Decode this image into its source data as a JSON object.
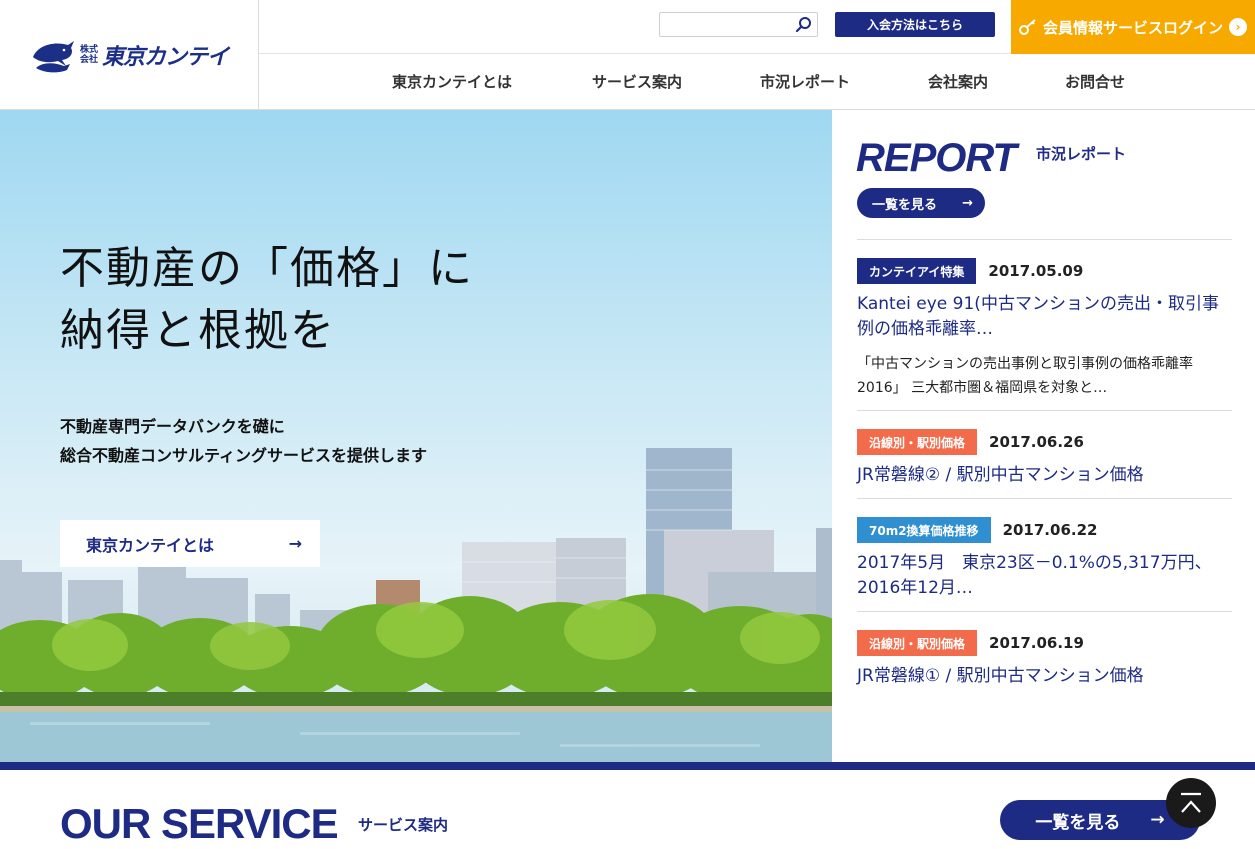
{
  "header": {
    "logo": {
      "sub_line1": "株式",
      "sub_line2": "会社",
      "name": "東京カンテイ"
    },
    "search": {
      "placeholder": "",
      "icon": "search-icon"
    },
    "join_label": "入会方法はこちら",
    "login_label": "会員情報サービスログイン",
    "login_icon": "key-icon",
    "nav": [
      {
        "label": "東京カンテイとは"
      },
      {
        "label": "サービス案内"
      },
      {
        "label": "市況レポート"
      },
      {
        "label": "会社案内"
      },
      {
        "label": "お問合せ"
      }
    ]
  },
  "hero": {
    "title_line1": "不動産の「価格」に",
    "title_line2": "納得と根拠を",
    "lead_line1": "不動産専門データバンクを礎に",
    "lead_line2": "総合不動産コンサルティングサービスを提供します",
    "button_label": "東京カンテイとは",
    "arrow": "→"
  },
  "report": {
    "heading_en": "REPORT",
    "heading_ja": "市況レポート",
    "all_label": "一覧を見る",
    "arrow": "→",
    "items": [
      {
        "tag": "カンテイアイ特集",
        "tag_color": "#1e2b84",
        "date": "2017.05.09",
        "title": "Kantei eye 91(中古マンションの売出・取引事例の価格乖離率…",
        "desc": "「中古マンションの売出事例と取引事例の価格乖離率 2016」 三大都市圏＆福岡県を対象と…"
      },
      {
        "tag": "沿線別・駅別価格",
        "tag_color": "#f26b4a",
        "date": "2017.06.26",
        "title": "JR常磐線② / 駅別中古マンション価格",
        "desc": ""
      },
      {
        "tag": "70m2換算価格推移",
        "tag_color": "#2f8fd0",
        "date": "2017.06.22",
        "title": "2017年5月　東京23区－0.1%の5,317万円、2016年12月…",
        "desc": ""
      },
      {
        "tag": "沿線別・駅別価格",
        "tag_color": "#f26b4a",
        "date": "2017.06.19",
        "title": "JR常磐線① / 駅別中古マンション価格",
        "desc": ""
      }
    ]
  },
  "service": {
    "heading_en": "OUR SERVICE",
    "heading_ja": "サービス案内",
    "all_label": "一覧を見る",
    "arrow": "→"
  },
  "colors": {
    "brand": "#1e2b84",
    "login": "#f7a900",
    "tag_orange": "#f26b4a",
    "tag_blue": "#2f8fd0"
  }
}
